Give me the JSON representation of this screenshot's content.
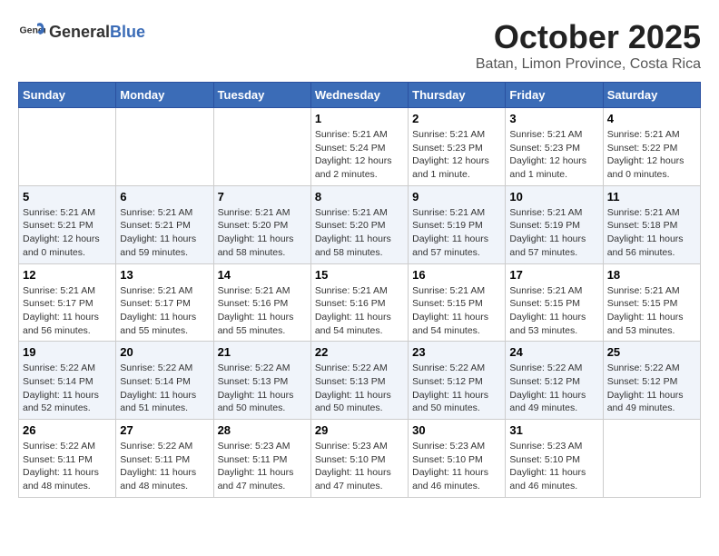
{
  "header": {
    "logo_general": "General",
    "logo_blue": "Blue",
    "month_title": "October 2025",
    "subtitle": "Batan, Limon Province, Costa Rica"
  },
  "weekdays": [
    "Sunday",
    "Monday",
    "Tuesday",
    "Wednesday",
    "Thursday",
    "Friday",
    "Saturday"
  ],
  "weeks": [
    [
      {
        "day": "",
        "info": ""
      },
      {
        "day": "",
        "info": ""
      },
      {
        "day": "",
        "info": ""
      },
      {
        "day": "1",
        "info": "Sunrise: 5:21 AM\nSunset: 5:24 PM\nDaylight: 12 hours and 2 minutes."
      },
      {
        "day": "2",
        "info": "Sunrise: 5:21 AM\nSunset: 5:23 PM\nDaylight: 12 hours and 1 minute."
      },
      {
        "day": "3",
        "info": "Sunrise: 5:21 AM\nSunset: 5:23 PM\nDaylight: 12 hours and 1 minute."
      },
      {
        "day": "4",
        "info": "Sunrise: 5:21 AM\nSunset: 5:22 PM\nDaylight: 12 hours and 0 minutes."
      }
    ],
    [
      {
        "day": "5",
        "info": "Sunrise: 5:21 AM\nSunset: 5:21 PM\nDaylight: 12 hours and 0 minutes."
      },
      {
        "day": "6",
        "info": "Sunrise: 5:21 AM\nSunset: 5:21 PM\nDaylight: 11 hours and 59 minutes."
      },
      {
        "day": "7",
        "info": "Sunrise: 5:21 AM\nSunset: 5:20 PM\nDaylight: 11 hours and 58 minutes."
      },
      {
        "day": "8",
        "info": "Sunrise: 5:21 AM\nSunset: 5:20 PM\nDaylight: 11 hours and 58 minutes."
      },
      {
        "day": "9",
        "info": "Sunrise: 5:21 AM\nSunset: 5:19 PM\nDaylight: 11 hours and 57 minutes."
      },
      {
        "day": "10",
        "info": "Sunrise: 5:21 AM\nSunset: 5:19 PM\nDaylight: 11 hours and 57 minutes."
      },
      {
        "day": "11",
        "info": "Sunrise: 5:21 AM\nSunset: 5:18 PM\nDaylight: 11 hours and 56 minutes."
      }
    ],
    [
      {
        "day": "12",
        "info": "Sunrise: 5:21 AM\nSunset: 5:17 PM\nDaylight: 11 hours and 56 minutes."
      },
      {
        "day": "13",
        "info": "Sunrise: 5:21 AM\nSunset: 5:17 PM\nDaylight: 11 hours and 55 minutes."
      },
      {
        "day": "14",
        "info": "Sunrise: 5:21 AM\nSunset: 5:16 PM\nDaylight: 11 hours and 55 minutes."
      },
      {
        "day": "15",
        "info": "Sunrise: 5:21 AM\nSunset: 5:16 PM\nDaylight: 11 hours and 54 minutes."
      },
      {
        "day": "16",
        "info": "Sunrise: 5:21 AM\nSunset: 5:15 PM\nDaylight: 11 hours and 54 minutes."
      },
      {
        "day": "17",
        "info": "Sunrise: 5:21 AM\nSunset: 5:15 PM\nDaylight: 11 hours and 53 minutes."
      },
      {
        "day": "18",
        "info": "Sunrise: 5:21 AM\nSunset: 5:15 PM\nDaylight: 11 hours and 53 minutes."
      }
    ],
    [
      {
        "day": "19",
        "info": "Sunrise: 5:22 AM\nSunset: 5:14 PM\nDaylight: 11 hours and 52 minutes."
      },
      {
        "day": "20",
        "info": "Sunrise: 5:22 AM\nSunset: 5:14 PM\nDaylight: 11 hours and 51 minutes."
      },
      {
        "day": "21",
        "info": "Sunrise: 5:22 AM\nSunset: 5:13 PM\nDaylight: 11 hours and 50 minutes."
      },
      {
        "day": "22",
        "info": "Sunrise: 5:22 AM\nSunset: 5:13 PM\nDaylight: 11 hours and 50 minutes."
      },
      {
        "day": "23",
        "info": "Sunrise: 5:22 AM\nSunset: 5:12 PM\nDaylight: 11 hours and 50 minutes."
      },
      {
        "day": "24",
        "info": "Sunrise: 5:22 AM\nSunset: 5:12 PM\nDaylight: 11 hours and 49 minutes."
      },
      {
        "day": "25",
        "info": "Sunrise: 5:22 AM\nSunset: 5:12 PM\nDaylight: 11 hours and 49 minutes."
      }
    ],
    [
      {
        "day": "26",
        "info": "Sunrise: 5:22 AM\nSunset: 5:11 PM\nDaylight: 11 hours and 48 minutes."
      },
      {
        "day": "27",
        "info": "Sunrise: 5:22 AM\nSunset: 5:11 PM\nDaylight: 11 hours and 48 minutes."
      },
      {
        "day": "28",
        "info": "Sunrise: 5:23 AM\nSunset: 5:11 PM\nDaylight: 11 hours and 47 minutes."
      },
      {
        "day": "29",
        "info": "Sunrise: 5:23 AM\nSunset: 5:10 PM\nDaylight: 11 hours and 47 minutes."
      },
      {
        "day": "30",
        "info": "Sunrise: 5:23 AM\nSunset: 5:10 PM\nDaylight: 11 hours and 46 minutes."
      },
      {
        "day": "31",
        "info": "Sunrise: 5:23 AM\nSunset: 5:10 PM\nDaylight: 11 hours and 46 minutes."
      },
      {
        "day": "",
        "info": ""
      }
    ]
  ]
}
